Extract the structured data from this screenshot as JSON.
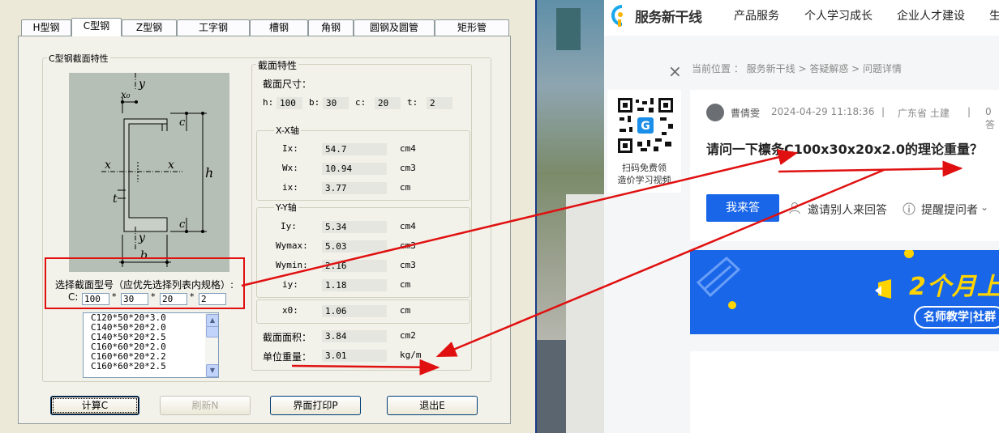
{
  "dialog": {
    "tabs": [
      "H型钢",
      "C型钢",
      "Z型钢",
      "工字钢",
      "槽钢",
      "角钢",
      "圆钢及圆管",
      "矩形管"
    ],
    "group_title": "C型钢截面特性",
    "diagram_labels": {
      "y_top": "y",
      "x0": "x₀",
      "c_top": "c",
      "h": "h",
      "x_left": "x",
      "x_right": "x",
      "t": "t",
      "c_bottom": "c",
      "y_bottom": "y",
      "b": "b"
    },
    "select_prompt": "选择截面型号（应优先选择列表内规格）:",
    "c_label": "C:",
    "inputs": [
      "100",
      "30",
      "20",
      "2"
    ],
    "times": "*",
    "list_items": [
      "C120*50*20*3.0",
      "C140*50*20*2.0",
      "C140*50*20*2.5",
      "C160*60*20*2.0",
      "C160*60*20*2.2",
      "C160*60*20*2.5"
    ],
    "props_title": "截面特性",
    "dim_title": "截面尺寸：",
    "dims": [
      {
        "label": "h:",
        "value": "100"
      },
      {
        "label": "b:",
        "value": "30"
      },
      {
        "label": "c:",
        "value": "20"
      },
      {
        "label": "t:",
        "value": "2"
      }
    ],
    "xx_title": "X-X轴",
    "yy_title": "Y-Y轴",
    "props": [
      {
        "label": "Ix:",
        "value": "54.7",
        "unit": "cm4"
      },
      {
        "label": "Wx:",
        "value": "10.94",
        "unit": "cm3"
      },
      {
        "label": "ix:",
        "value": "3.77",
        "unit": "cm"
      },
      {
        "label": "Iy:",
        "value": "5.34",
        "unit": "cm4"
      },
      {
        "label": "Wymax:",
        "value": "5.03",
        "unit": "cm3"
      },
      {
        "label": "Wymin:",
        "value": "2.16",
        "unit": "cm3"
      },
      {
        "label": "iy:",
        "value": "1.18",
        "unit": "cm"
      },
      {
        "label": "x0:",
        "value": "1.06",
        "unit": "cm"
      }
    ],
    "area": {
      "label": "截面面积：",
      "value": "3.84",
      "unit": "cm2"
    },
    "weight": {
      "label": "单位重量：",
      "value": "3.01",
      "unit": "kg/m"
    },
    "buttons": {
      "calc": "计算C",
      "refresh": "刷新N",
      "print": "界面打印P",
      "exit": "退出E"
    }
  },
  "website": {
    "logo_text": "服务新干线",
    "nav": [
      "产品服务",
      "个人学习成长",
      "企业人才建设",
      "生"
    ],
    "breadcrumb": "当前位置 ： 服务新干线 > 答疑解惑 > 问题详情",
    "close": "×",
    "qr_caption_1": "扫码免费领",
    "qr_caption_2": "造价学习视频",
    "author": "曹倩雯",
    "date": "2024-04-29 11:18:36",
    "sep": "|",
    "region": "广东省  土建",
    "answers": "0答",
    "question": "请问一下檩条C100x30x20x2.0的理论重量？",
    "answer_btn": "我来答",
    "invite": "邀请别人来回答",
    "remind": "提醒提问者",
    "banner_big": "2个月上",
    "banner_small": "名师教学|社群",
    "colors": {
      "primary": "#1966e8",
      "banner_yellow": "#ffd400"
    }
  }
}
